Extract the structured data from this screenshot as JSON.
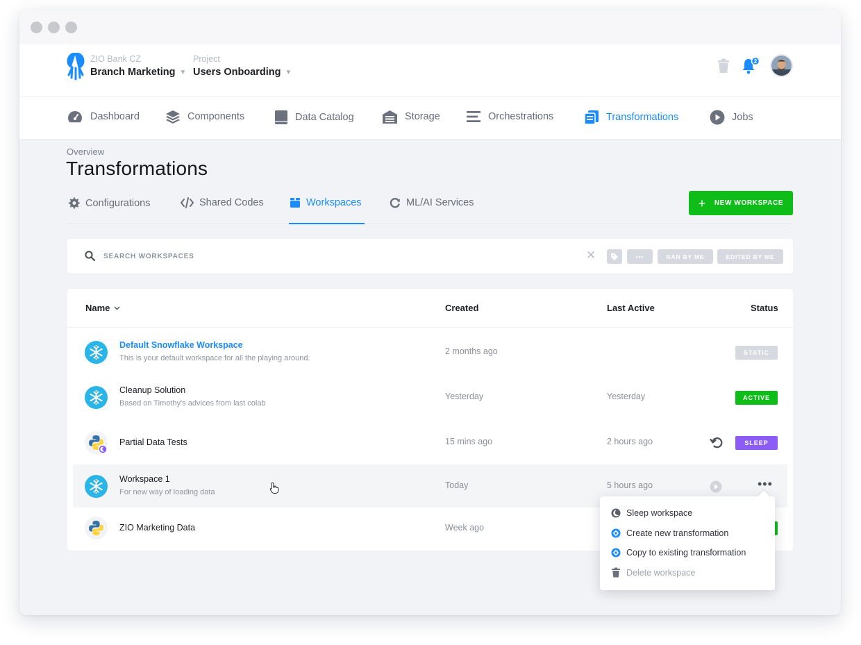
{
  "header": {
    "org_label": "ZIO Bank CZ",
    "org_name": "Branch Marketing",
    "project_label": "Project",
    "project_name": "Users Onboarding",
    "notification_count": "2"
  },
  "nav": {
    "items": [
      {
        "label": "Dashboard",
        "icon": "gauge-icon"
      },
      {
        "label": "Components",
        "icon": "layers-icon"
      },
      {
        "label": "Data Catalog",
        "icon": "book-icon"
      },
      {
        "label": "Storage",
        "icon": "warehouse-icon"
      },
      {
        "label": "Orchestrations",
        "icon": "bars-icon"
      },
      {
        "label": "Transformations",
        "icon": "copy-icon",
        "active": true
      },
      {
        "label": "Jobs",
        "icon": "play-circle-icon"
      }
    ]
  },
  "page": {
    "overline": "Overview",
    "title": "Transformations"
  },
  "subtabs": [
    {
      "label": "Configurations",
      "icon": "gear-icon"
    },
    {
      "label": "Shared Codes",
      "icon": "code-icon"
    },
    {
      "label": "Workspaces",
      "icon": "box-icon",
      "active": true
    },
    {
      "label": "ML/AI Services",
      "icon": "refresh-icon"
    }
  ],
  "new_workspace_label": "NEW WORKSPACE",
  "search": {
    "placeholder": "SEARCH WORKSPACES",
    "chips": [
      "•••",
      "RAN BY ME",
      "EDITED BY ME"
    ]
  },
  "table": {
    "columns": {
      "name": "Name",
      "created": "Created",
      "last_active": "Last Active",
      "status": "Status"
    },
    "rows": [
      {
        "name": "Default Snowflake Workspace",
        "desc": "This is your default workspace for all the playing around.",
        "created": "2 months ago",
        "last_active": "",
        "status": "STATIC",
        "type": "snowflake"
      },
      {
        "name": "Cleanup Solution",
        "desc": "Based on Timothy's advices from last colab",
        "created": "Yesterday",
        "last_active": "Yesterday",
        "status": "ACTIVE",
        "type": "snowflake"
      },
      {
        "name": "Partial Data Tests",
        "desc": "",
        "created": "15 mins ago",
        "last_active": "2 hours ago",
        "status": "SLEEP",
        "type": "python"
      },
      {
        "name": "Workspace 1",
        "desc": "For new way of loading data",
        "created": "Today",
        "last_active": "5 hours ago",
        "status": "",
        "type": "snowflake"
      },
      {
        "name": "ZIO Marketing Data",
        "desc": "",
        "created": "Week ago",
        "last_active": "",
        "status": "",
        "type": "python"
      }
    ]
  },
  "context_menu": {
    "items": [
      {
        "label": "Sleep workspace",
        "icon": "moon-icon"
      },
      {
        "label": "Create new transformation",
        "icon": "gear-badge-icon"
      },
      {
        "label": "Copy to existing transformation",
        "icon": "gear-badge-icon"
      },
      {
        "label": "Delete workspace",
        "icon": "trash-icon",
        "disabled": true
      }
    ]
  },
  "colors": {
    "accent": "#1a8cff",
    "success": "#0fbd18",
    "sleep": "#8b5cf6",
    "static": "#d6d9e0",
    "snowflake": "#29b5e8"
  }
}
